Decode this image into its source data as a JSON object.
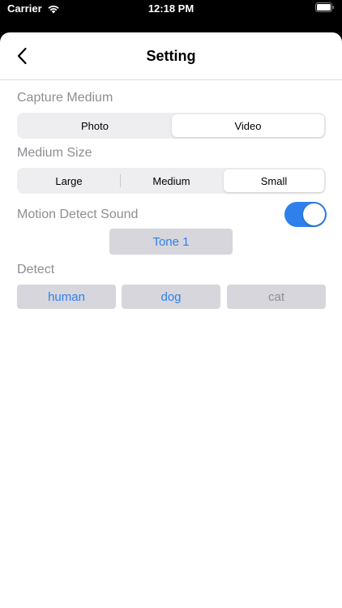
{
  "status_bar": {
    "carrier": "Carrier",
    "time": "12:18 PM"
  },
  "nav": {
    "title": "Setting"
  },
  "capture_medium": {
    "label": "Capture Medium",
    "options": [
      "Photo",
      "Video"
    ],
    "selected": "Video"
  },
  "medium_size": {
    "label": "Medium Size",
    "options": [
      "Large",
      "Medium",
      "Small"
    ],
    "selected": "Small"
  },
  "motion_detect_sound": {
    "label": "Motion Detect Sound",
    "enabled": true,
    "tone_label": "Tone 1"
  },
  "detect": {
    "label": "Detect",
    "options": [
      {
        "label": "human",
        "active": true
      },
      {
        "label": "dog",
        "active": true
      },
      {
        "label": "cat",
        "active": false
      }
    ]
  },
  "colors": {
    "accent": "#2f80ed",
    "inactive_text": "#8e8e93",
    "button_bg": "#d6d6dc"
  }
}
